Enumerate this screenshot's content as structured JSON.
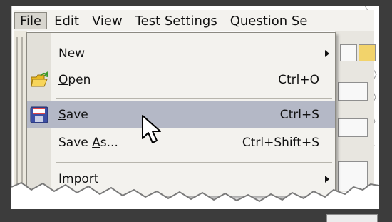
{
  "menubar": {
    "items": [
      {
        "pre": "",
        "ul": "F",
        "post": "ile"
      },
      {
        "pre": "",
        "ul": "E",
        "post": "dit"
      },
      {
        "pre": "",
        "ul": "V",
        "post": "iew"
      },
      {
        "pre": "",
        "ul": "T",
        "post": "est Settings"
      },
      {
        "pre": "",
        "ul": "Q",
        "post": "uestion Se"
      }
    ]
  },
  "file_menu": {
    "new": {
      "label": "New",
      "has_submenu": true
    },
    "open": {
      "ul": "O",
      "rest": "pen",
      "shortcut": "Ctrl+O",
      "icon": "open-folder-icon"
    },
    "save": {
      "ul": "S",
      "rest": "ave",
      "shortcut": "Ctrl+S",
      "icon": "floppy-disk-icon",
      "highlighted": true
    },
    "save_as": {
      "pre": "Save ",
      "ul": "A",
      "post": "s...",
      "shortcut": "Ctrl+Shift+S"
    },
    "import": {
      "label": "Import",
      "has_submenu": true
    }
  },
  "colors": {
    "menu_bg": "#f3f2ee",
    "highlight": "#b4b8c6",
    "frame": "#3c3c3c"
  },
  "icons": {
    "cursor": "mouse-pointer-icon",
    "submenu": "submenu-arrow-icon"
  }
}
